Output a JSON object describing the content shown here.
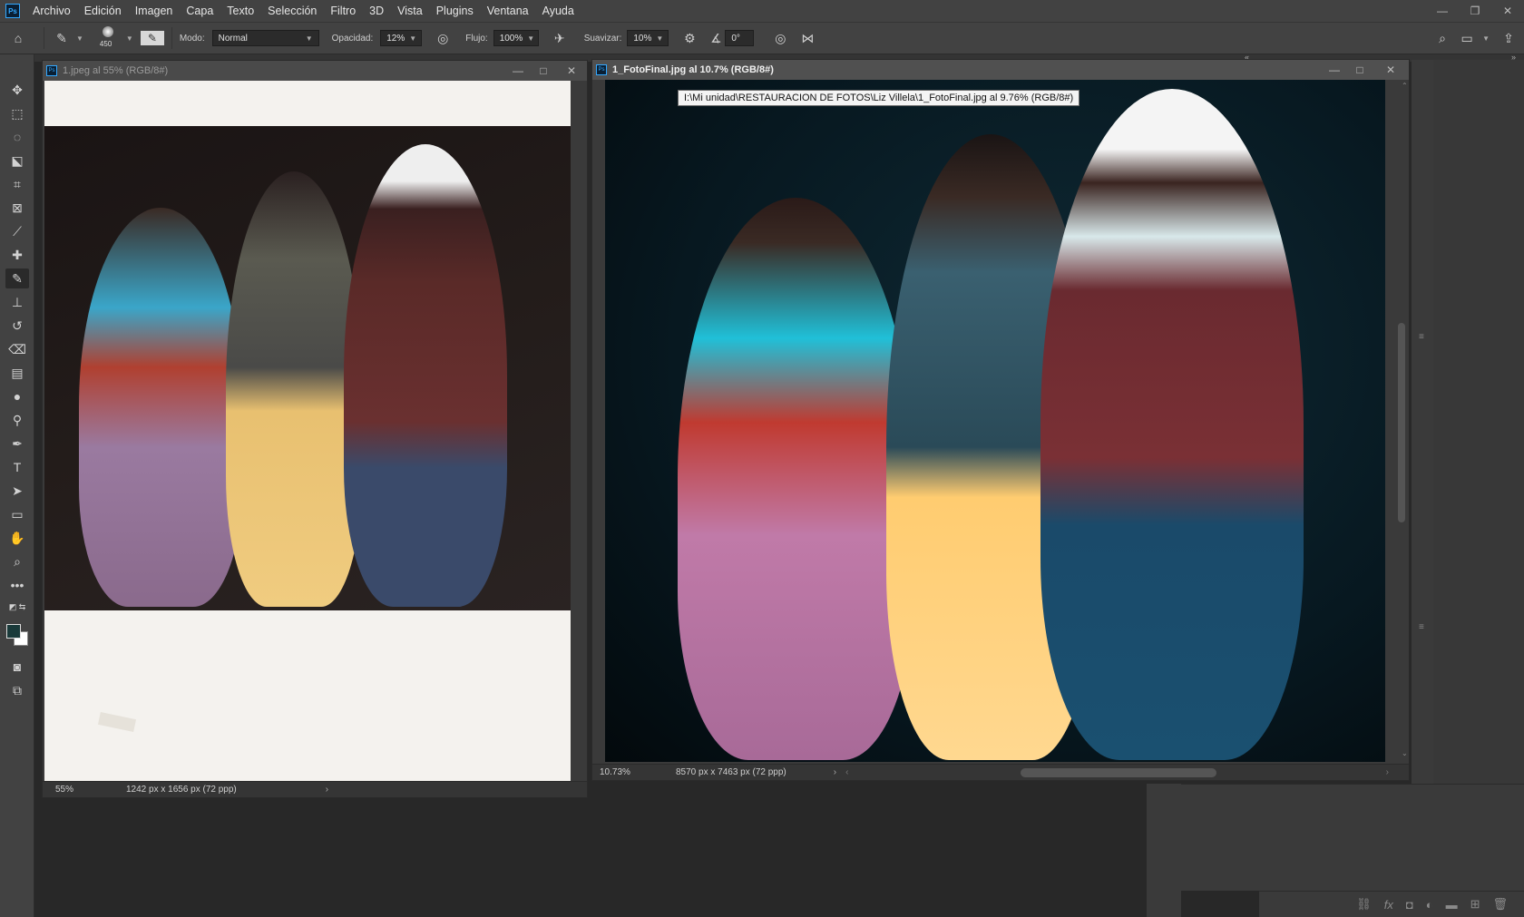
{
  "menu": [
    "Archivo",
    "Edición",
    "Imagen",
    "Capa",
    "Texto",
    "Selección",
    "Filtro",
    "3D",
    "Vista",
    "Plugins",
    "Ventana",
    "Ayuda"
  ],
  "app_icon": "Ps",
  "options": {
    "brush_size": "450",
    "mode_label": "Modo:",
    "mode_value": "Normal",
    "opacity_label": "Opacidad:",
    "opacity_value": "12%",
    "flow_label": "Flujo:",
    "flow_value": "100%",
    "smoothing_label": "Suavizar:",
    "smoothing_value": "10%",
    "angle_value": "0°"
  },
  "doc1": {
    "tab_icon": "Ps",
    "title": "1.jpeg al 55% (RGB/8#)",
    "zoom": "55%",
    "dimensions": "1242 px x 1656 px (72 ppp)"
  },
  "doc2": {
    "tab_icon": "Ps",
    "title": "1_FotoFinal.jpg al 10.7% (RGB/8#)",
    "zoom": "10.73%",
    "dimensions": "8570 px x 7463 px (72 ppp)",
    "tooltip": "I:\\Mi unidad\\RESTAURACION DE FOTOS\\Liz Villela\\1_FotoFinal.jpg al 9.76% (RGB/8#)"
  },
  "colors": {
    "chrome": "#424242",
    "canvas_bg": "#282828",
    "accent": "#31a8ff"
  }
}
